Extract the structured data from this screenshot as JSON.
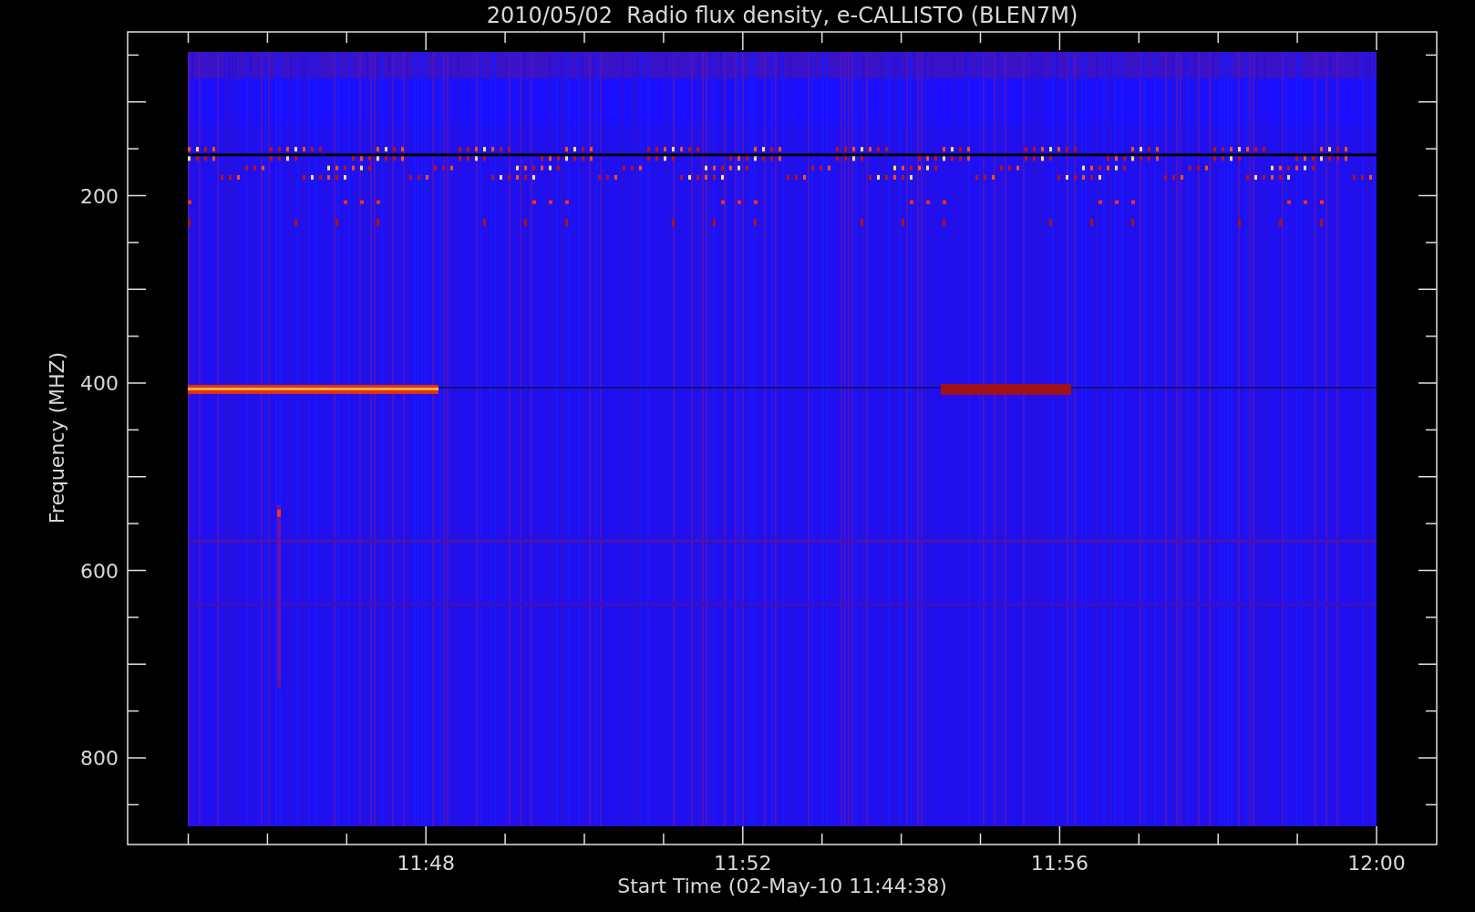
{
  "plot": {
    "title": "2010/05/02  Radio flux density, e-CALLISTO (BLEN7M)",
    "xlabel": "Start Time (02-May-10 11:44:38)",
    "ylabel": "Frequency (MHZ)",
    "xticks": [
      "11:48",
      "11:52",
      "11:56",
      "12:00"
    ],
    "yticks": [
      "200",
      "400",
      "600",
      "800"
    ]
  }
}
